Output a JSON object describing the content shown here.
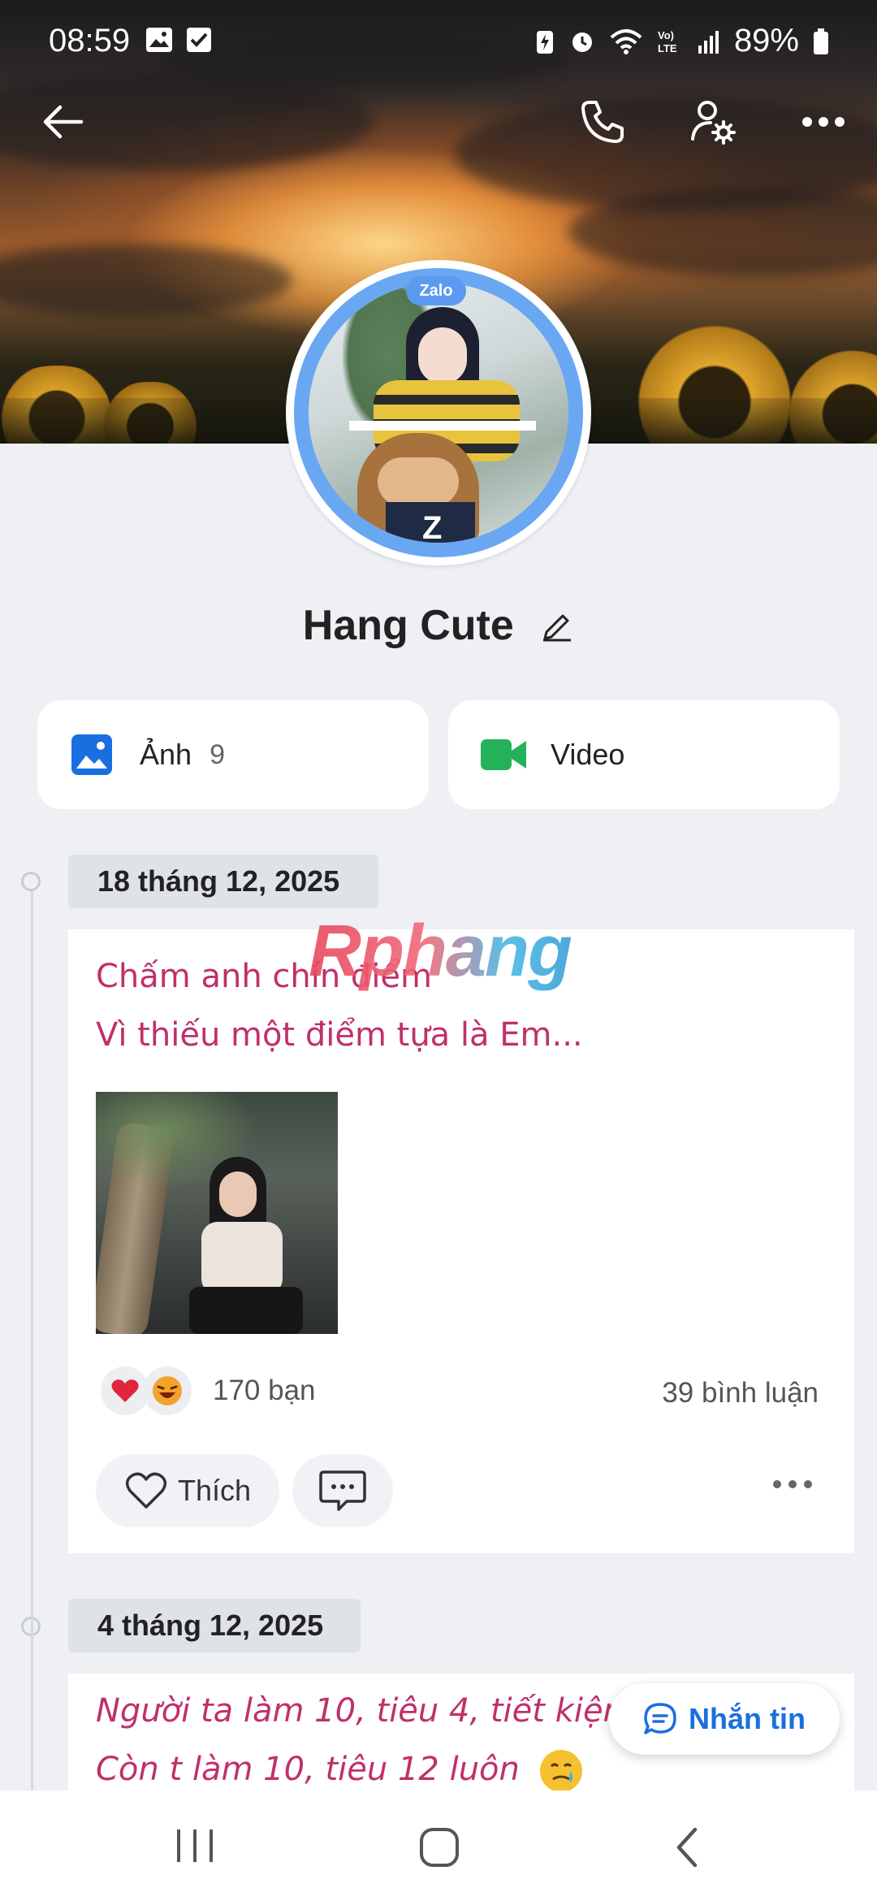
{
  "status": {
    "time": "08:59",
    "battery": "89%"
  },
  "profile": {
    "name": "Hang Cute",
    "badge": "Zalo"
  },
  "media": {
    "photos": {
      "label": "Ảnh",
      "count": "9"
    },
    "video": {
      "label": "Video"
    }
  },
  "watermark": "Rphang",
  "posts": [
    {
      "date": "18 tháng 12, 2025",
      "lines": [
        "Chấm anh chín điểm",
        "Vì thiếu một điểm tựa là Em..."
      ],
      "reactions_text": "170 bạn",
      "comments_text": "39 bình luận",
      "like_label": "Thích"
    },
    {
      "date": "4 tháng 12, 2025",
      "lines": [
        "Người ta làm 10, tiêu 4, tiết kiệm 6",
        "Còn t làm 10, tiêu 12 luôn"
      ]
    }
  ],
  "fab": {
    "label": "Nhắn tin"
  },
  "colors": {
    "accent": "#1a6fe0",
    "post_text": "#c0306a",
    "video_icon": "#25b15a",
    "photo_icon": "#1a6fe0"
  }
}
